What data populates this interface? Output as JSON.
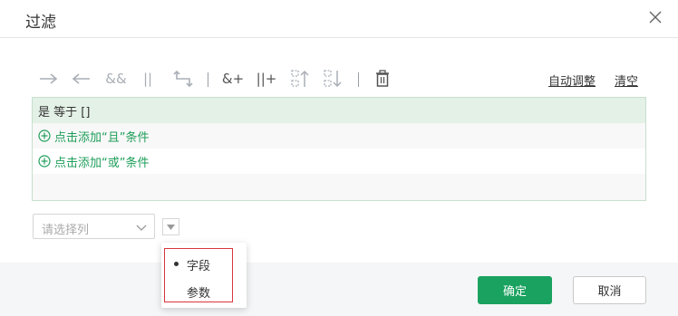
{
  "dialog": {
    "title": "过滤",
    "close_label": "×"
  },
  "toolbar": {
    "auto_adjust": "自动调整",
    "clear": "清空",
    "and_label": "&&",
    "or_label": "||",
    "add_and_label": "&+",
    "add_or_label": "||+"
  },
  "filter": {
    "condition": "是 等于 []",
    "add_and": "点击添加“且”条件",
    "add_or": "点击添加“或”条件"
  },
  "column_select": {
    "placeholder": "请选择列"
  },
  "popup": {
    "items": [
      "字段",
      "参数"
    ]
  },
  "buttons": {
    "ok": "确定",
    "cancel": "取消"
  },
  "colors": {
    "accent": "#1aa260",
    "link_green": "#1f9e5a",
    "highlight_row": "#e4f1e6",
    "annotation_red": "#d9363e"
  }
}
